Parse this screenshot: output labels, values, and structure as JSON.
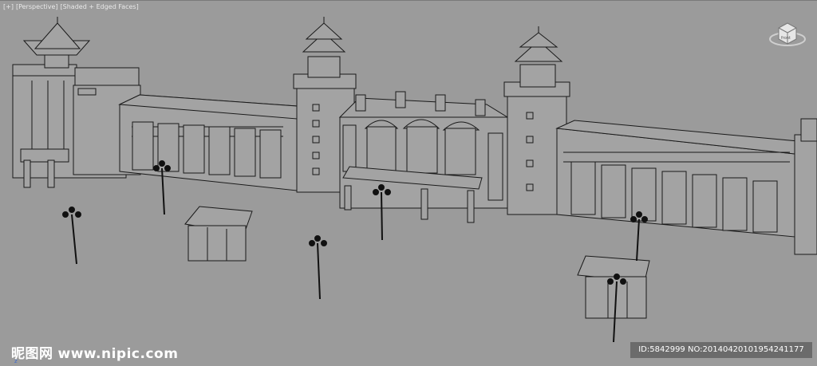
{
  "viewport": {
    "menu_label": "[+]",
    "view_label": "[Perspective]",
    "shading_label": "[Shaded + Edged Faces]",
    "viewcube_label": "front"
  },
  "axis_label": "z",
  "watermark": {
    "logo_text": "昵图网",
    "site_text": "www.nipic.com"
  },
  "image_id": "ID:5842999 NO:20140420101954241177",
  "colors": {
    "background": "#9b9b9b",
    "building_fill": "#a3a3a3",
    "edge": "#1a1a1a",
    "label_text": "#e8e8e8"
  },
  "icons": [
    "viewcube-icon",
    "street-lamp-icon",
    "kiosk-icon"
  ]
}
